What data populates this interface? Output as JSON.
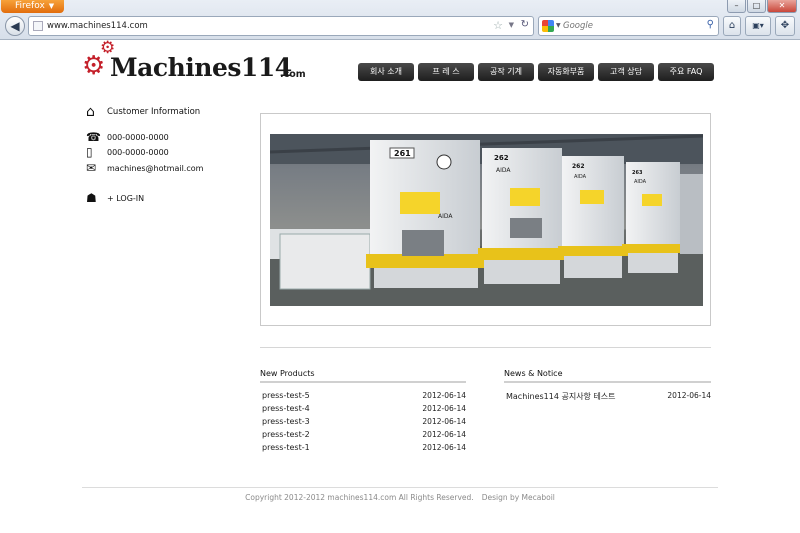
{
  "browser": {
    "app_button": "Firefox",
    "url": "www.machines114.com",
    "search_placeholder": "Google"
  },
  "logo": {
    "name": "Machines114",
    "suffix": ".com"
  },
  "nav": [
    {
      "label": "회사 소개"
    },
    {
      "label": "프 레 스"
    },
    {
      "label": "공작 기계"
    },
    {
      "label": "자동화부품"
    },
    {
      "label": "고객 상담"
    },
    {
      "label": "주요 FAQ"
    }
  ],
  "sidebar": {
    "title": "Customer Information",
    "phone": "000-0000-0000",
    "mobile": "000-0000-0000",
    "email": "machines@hotmail.com",
    "login": "+ LOG-IN"
  },
  "hero": {
    "machines": [
      {
        "number": "261",
        "brand": "AIDA"
      },
      {
        "number": "262",
        "brand": "AIDA"
      },
      {
        "number": "262",
        "brand": "AIDA"
      },
      {
        "number": "263",
        "brand": "AIDA"
      }
    ]
  },
  "new_products": {
    "title": "New Products",
    "items": [
      {
        "name": "press-test-5",
        "date": "2012-06-14"
      },
      {
        "name": "press-test-4",
        "date": "2012-06-14"
      },
      {
        "name": "press-test-3",
        "date": "2012-06-14"
      },
      {
        "name": "press-test-2",
        "date": "2012-06-14"
      },
      {
        "name": "press-test-1",
        "date": "2012-06-14"
      }
    ]
  },
  "news": {
    "title": "News & Notice",
    "items": [
      {
        "name": "Machines114 공지사항 테스트",
        "date": "2012-06-14"
      }
    ]
  },
  "footer": {
    "copyright": "Copyright 2012-2012 machines114.com All Rights Reserved.",
    "design": "Design by Mecaboil"
  }
}
